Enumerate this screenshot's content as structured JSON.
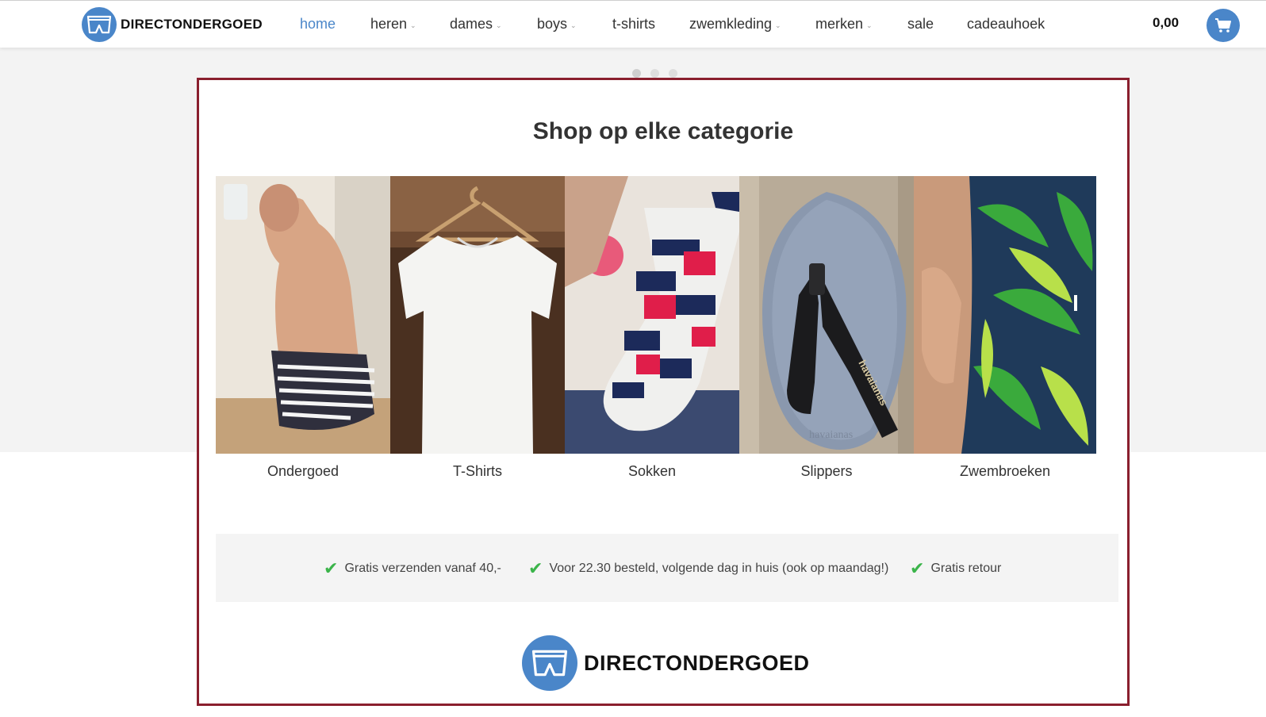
{
  "brand": {
    "name": "DIRECTONDERGOED",
    "logo_icon": "boxer-briefs-icon",
    "color": "#4a86c9"
  },
  "nav": {
    "items": [
      {
        "label": "home",
        "active": true,
        "has_dropdown": false
      },
      {
        "label": "heren",
        "active": false,
        "has_dropdown": true
      },
      {
        "label": "dames",
        "active": false,
        "has_dropdown": true
      },
      {
        "label": "boys",
        "active": false,
        "has_dropdown": true
      },
      {
        "label": "t-shirts",
        "active": false,
        "has_dropdown": false
      },
      {
        "label": "zwemkleding",
        "active": false,
        "has_dropdown": true
      },
      {
        "label": "merken",
        "active": false,
        "has_dropdown": true
      },
      {
        "label": "sale",
        "active": false,
        "has_dropdown": false
      },
      {
        "label": "cadeauhoek",
        "active": false,
        "has_dropdown": false
      }
    ]
  },
  "cart": {
    "amount": "0,00",
    "icon": "cart-icon"
  },
  "carousel": {
    "dots": 3,
    "active_index": 0
  },
  "main": {
    "title": "Shop op elke categorie",
    "categories": [
      {
        "label": "Ondergoed",
        "image": "man-in-striped-boxers"
      },
      {
        "label": "T-Shirts",
        "image": "white-tshirt-on-hanger"
      },
      {
        "label": "Sokken",
        "image": "patterned-socks"
      },
      {
        "label": "Slippers",
        "image": "havaianas-flip-flop"
      },
      {
        "label": "Zwembroeken",
        "image": "tropical-swim-shorts"
      }
    ],
    "usps": [
      {
        "text": "Gratis verzenden vanaf 40,-",
        "icon": "check-icon"
      },
      {
        "text": "Voor 22.30 besteld, volgende dag in huis (ook op maandag!)",
        "icon": "check-icon"
      },
      {
        "text": "Gratis retour",
        "icon": "check-icon"
      }
    ],
    "footer_brand": "DIRECTONDERGOED"
  },
  "colors": {
    "accent": "#4a86c9",
    "panel_border": "#8a1f2e",
    "check": "#3bb44a"
  },
  "flipflop_print": {
    "strap_text": "havaianas",
    "sole_text": "havaianas"
  }
}
